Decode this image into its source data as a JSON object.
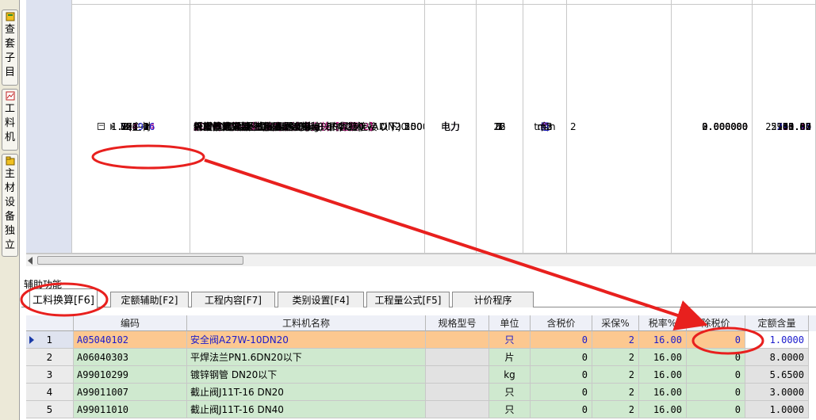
{
  "side_tabs": [
    {
      "label": "查套子目"
    },
    {
      "label": "工料机"
    },
    {
      "label": "主材设备独立"
    }
  ],
  "upper_table": {
    "rows": [
      {
        "no": "2",
        "code": "YJ1-2",
        "name": "人工挖土方 坚土 深2m以内",
        "fee": "电力",
        "n": "1",
        "unit": "m3",
        "qty": "2",
        "val": "2.000000",
        "price": "51.28"
      },
      {
        "no": "3",
        "code": "JQ1-1",
        "name": "20kV以下油浸式变压器安装 三相 容量(kVA以下) 250",
        "fee": "电力",
        "n": "7",
        "unit": "台",
        "qty": "",
        "val": "0.000000",
        "price": "780.43"
      },
      {
        "no": "4",
        "code": "JQ1-3",
        "name": "20kV以下油浸式变压器安装 三相 容量(kVA以下) 1000",
        "fee": "电力",
        "n": "7",
        "unit": "台",
        "qty": "",
        "val": "0.000000",
        "price": "2116.96"
      },
      {
        "no": "5",
        "code": "JQ1-2",
        "name": "20kV以下油浸式变压器安装 三相 容量(kVA以下) 500",
        "fee": "电力",
        "n": "7",
        "unit": "台",
        "qty": "",
        "val": "0.000000",
        "price": "948.00"
      },
      {
        "no": "6",
        "code": "B2主材",
        "name": "20kV以下油浸式变压器",
        "fee": "电力",
        "n": "3",
        "unit": "台",
        "qty": "",
        "val": "0.000000",
        "price": "25300.00"
      },
      {
        "no": "7",
        "code": "JQ4-24",
        "name": "屏柜内元件安装 盘内汇流排安装【定额*2】",
        "fee": "电力",
        "n": "7",
        "unit": "个",
        "qty": "",
        "val": "0.000000",
        "price": "128.18"
      },
      {
        "no": "8",
        "code": "JX1-1",
        "name": "人力运输 混凝土杆 每件重(kg) 500以内",
        "fee": "电力",
        "n": "12",
        "unit": "t.km",
        "qty": "",
        "val": "0.000000",
        "price": "370.85"
      },
      {
        "no": "9",
        "code": "YJ19-6",
        "name": "低压器具安装 减压器组合安装－－焊接连接 DN20",
        "fee": "电力",
        "n": "7",
        "unit": "组",
        "qty": "",
        "val": "0.000000",
        "price": "293.24"
      },
      {
        "no": "10",
        "code": "YJ1-4",
        "name": "人工挖土方 坚土 深4m以内",
        "fee": "电力",
        "n": "1",
        "unit": "m3",
        "qty": "",
        "val": "0.000000",
        "price": "65.07"
      },
      {
        "no": "11",
        "code": "CX1-1",
        "name": "杆塔基础拆除 基础混凝土拆除",
        "fee": "电力",
        "n": "26",
        "unit": "m3",
        "qty": "",
        "val": "0.000000",
        "price": "103.82"
      },
      {
        "no": "12",
        "code": "JQ6-2",
        "name": "人工开挖混凝土路面厚度(mm以内) 250",
        "fee": "电力",
        "n": "7",
        "unit": "m2",
        "qty": "",
        "val": "0.000000",
        "price": "61.52"
      },
      {
        "no": "",
        "code": "1.2",
        "name": "给排水",
        "fee": "",
        "n": "1",
        "unit": "",
        "qty": "",
        "val": "0.000000",
        "price": "0.00"
      },
      {
        "no": "",
        "code": "1.3",
        "name": "采暖、通风及空调",
        "fee": "",
        "n": "1",
        "unit": "",
        "qty": "",
        "val": "0.000000",
        "price": "0.00"
      }
    ]
  },
  "aux_label": "辅助功能",
  "tabs": [
    {
      "label": "工料换算[F6]"
    },
    {
      "label": "定额辅助[F2]"
    },
    {
      "label": "工程内容[F7]"
    },
    {
      "label": "类别设置[F4]"
    },
    {
      "label": "工程量公式[F5]"
    },
    {
      "label": "计价程序"
    }
  ],
  "lower_table": {
    "headers": [
      "编码",
      "工料机名称",
      "规格型号",
      "单位",
      "含税价",
      "采保%",
      "税率%",
      "除税价",
      "定额含量"
    ],
    "rows": [
      {
        "no": "1",
        "code": "A05040102",
        "name": "安全阀A27W-10DN20",
        "spec": "",
        "unit": "只",
        "tax_price": "0",
        "cb": "2",
        "rate": "16.00",
        "ex_price": "0",
        "qty": "1.0000"
      },
      {
        "no": "2",
        "code": "A06040303",
        "name": "平焊法兰PN1.6DN20以下",
        "spec": "",
        "unit": "片",
        "tax_price": "0",
        "cb": "2",
        "rate": "16.00",
        "ex_price": "0",
        "qty": "8.0000"
      },
      {
        "no": "3",
        "code": "A99010299",
        "name": "镀锌钢管 DN20以下",
        "spec": "",
        "unit": "kg",
        "tax_price": "0",
        "cb": "2",
        "rate": "16.00",
        "ex_price": "0",
        "qty": "5.6500"
      },
      {
        "no": "4",
        "code": "A99011007",
        "name": "截止阀J11T-16 DN20",
        "spec": "",
        "unit": "只",
        "tax_price": "0",
        "cb": "2",
        "rate": "16.00",
        "ex_price": "0",
        "qty": "3.0000"
      },
      {
        "no": "5",
        "code": "A99011010",
        "name": "截止阀J11T-16 DN40",
        "spec": "",
        "unit": "只",
        "tax_price": "0",
        "cb": "2",
        "rate": "16.00",
        "ex_price": "0",
        "qty": "1.0000"
      }
    ]
  },
  "colors": {
    "selected_row": "#fcc890",
    "highlight_cell": "#0a46c8",
    "group_row": "#f4a796",
    "material_row": "#cfe9cf",
    "annotation": "#e8201e"
  }
}
